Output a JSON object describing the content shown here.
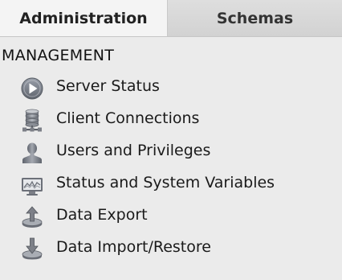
{
  "tabs": [
    {
      "label": "Administration",
      "active": true
    },
    {
      "label": "Schemas",
      "active": false
    }
  ],
  "section": {
    "title": "MANAGEMENT"
  },
  "items": [
    {
      "label": "Server Status",
      "icon": "play-circle-icon"
    },
    {
      "label": "Client Connections",
      "icon": "database-network-icon"
    },
    {
      "label": "Users and Privileges",
      "icon": "user-silhouette-icon"
    },
    {
      "label": "Status and System Variables",
      "icon": "monitor-chart-icon"
    },
    {
      "label": "Data Export",
      "icon": "export-upload-icon"
    },
    {
      "label": "Data Import/Restore",
      "icon": "import-download-icon"
    }
  ],
  "colors": {
    "background": "#ebebeb",
    "active_tab": "#f4f4f4",
    "inactive_tab": "#d6d6d6",
    "icon_gray": "#7d8088"
  }
}
